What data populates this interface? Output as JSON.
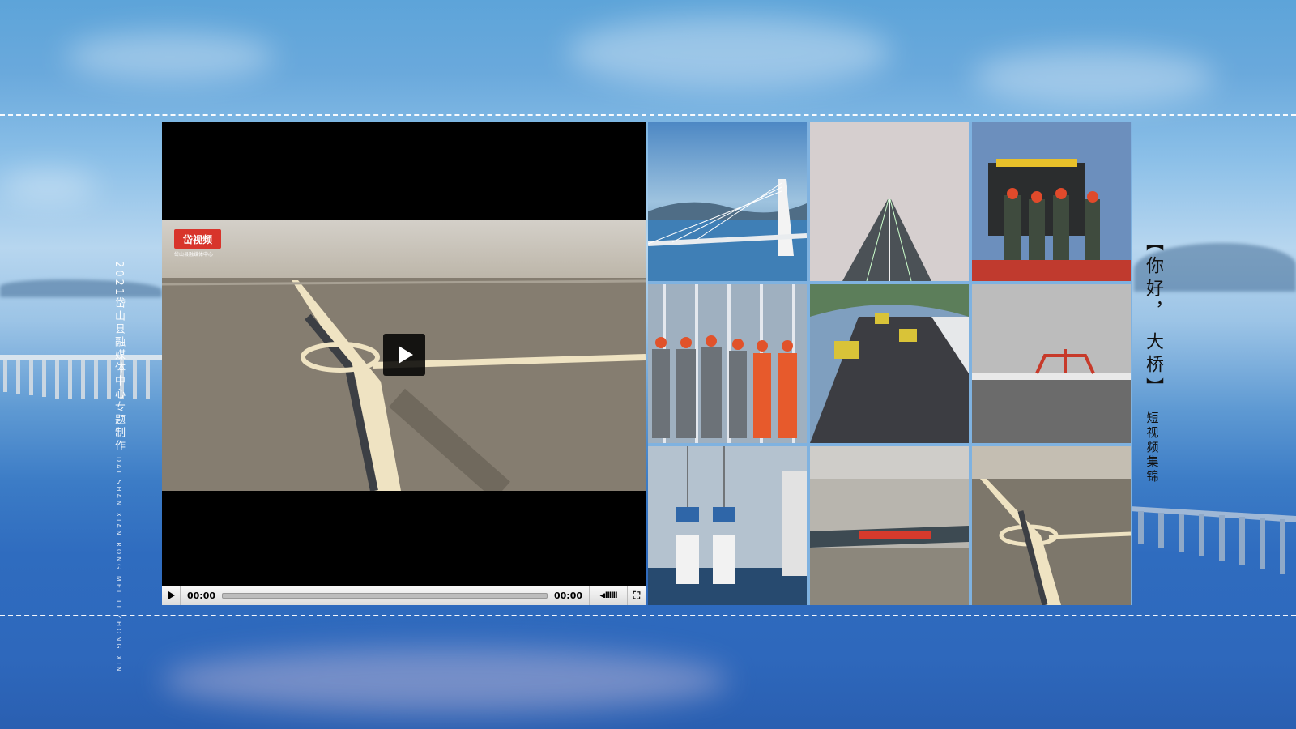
{
  "side_caption": {
    "cn": "2021岱山县融媒体中心专题制作",
    "en": "DAI SHAN XIAN RONG MEI TI ZHONG XIN"
  },
  "title": {
    "line1": "【你好，",
    "line2": "大桥】",
    "subtitle": "短视频集锦"
  },
  "video": {
    "badge": "岱视频",
    "badge_sub": "岱山县融媒体中心",
    "current_time": "00:00",
    "duration": "00:00",
    "volume_icon": "volume-icon",
    "fullscreen_icon": "fullscreen-icon"
  },
  "thumbnails": [
    {
      "name": "cable-stayed-pylon"
    },
    {
      "name": "foggy-highway"
    },
    {
      "name": "paving-crew"
    },
    {
      "name": "workers-group"
    },
    {
      "name": "road-rollers"
    },
    {
      "name": "bridge-crane-fog"
    },
    {
      "name": "pier-lifting"
    },
    {
      "name": "deck-segment"
    },
    {
      "name": "aerial-interchange"
    }
  ],
  "colors": {
    "dash": "#ffffff",
    "badge": "#d8342b"
  }
}
